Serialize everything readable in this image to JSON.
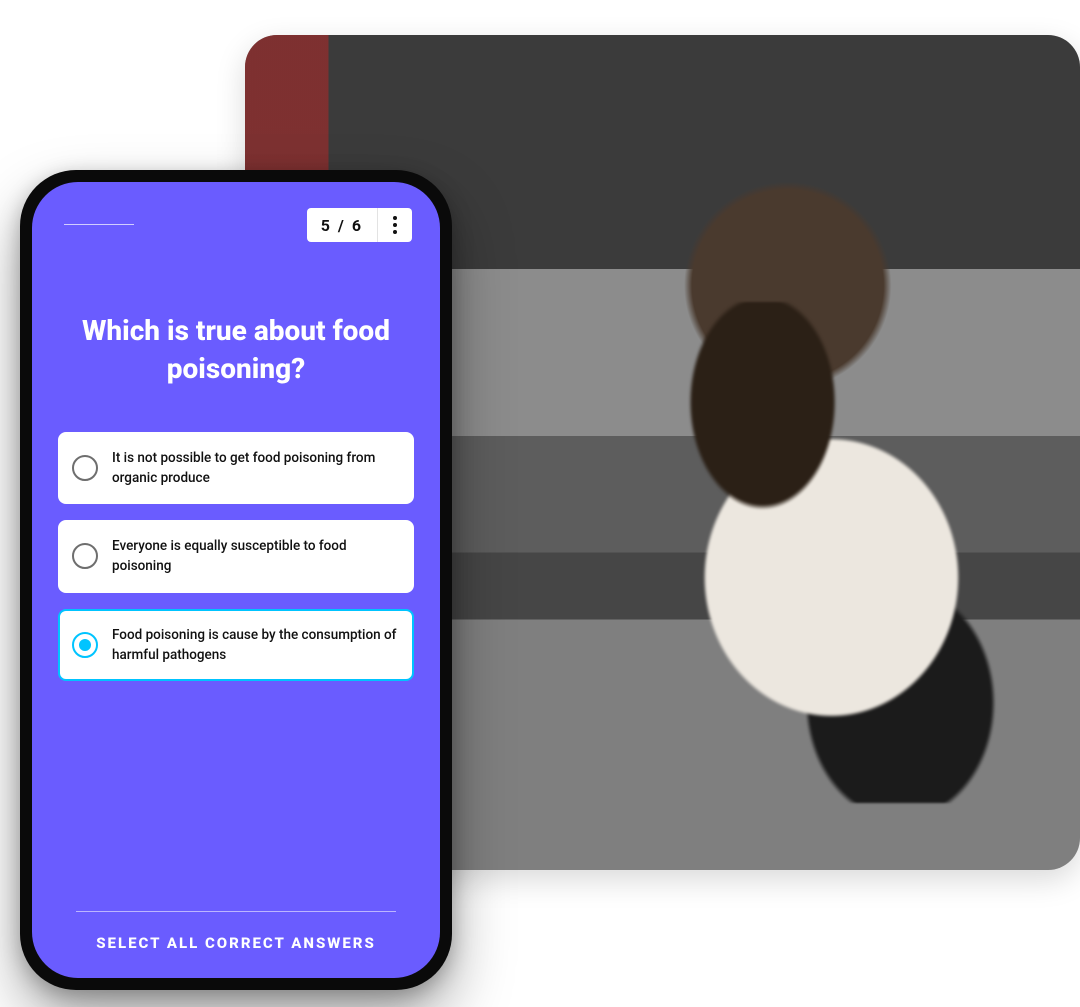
{
  "quiz": {
    "progress": "5 / 6",
    "question": "Which is true about food poisoning?",
    "answers": [
      {
        "text": "It is not possible to get food poisoning from organic produce",
        "selected": false
      },
      {
        "text": "Everyone is equally susceptible to food poisoning",
        "selected": false
      },
      {
        "text": "Food poisoning is cause by the consumption of harmful pathogens",
        "selected": true
      }
    ],
    "instruction": "SELECT ALL CORRECT ANSWERS"
  },
  "colors": {
    "primary": "#6a5cff",
    "accent": "#00c4ff"
  }
}
